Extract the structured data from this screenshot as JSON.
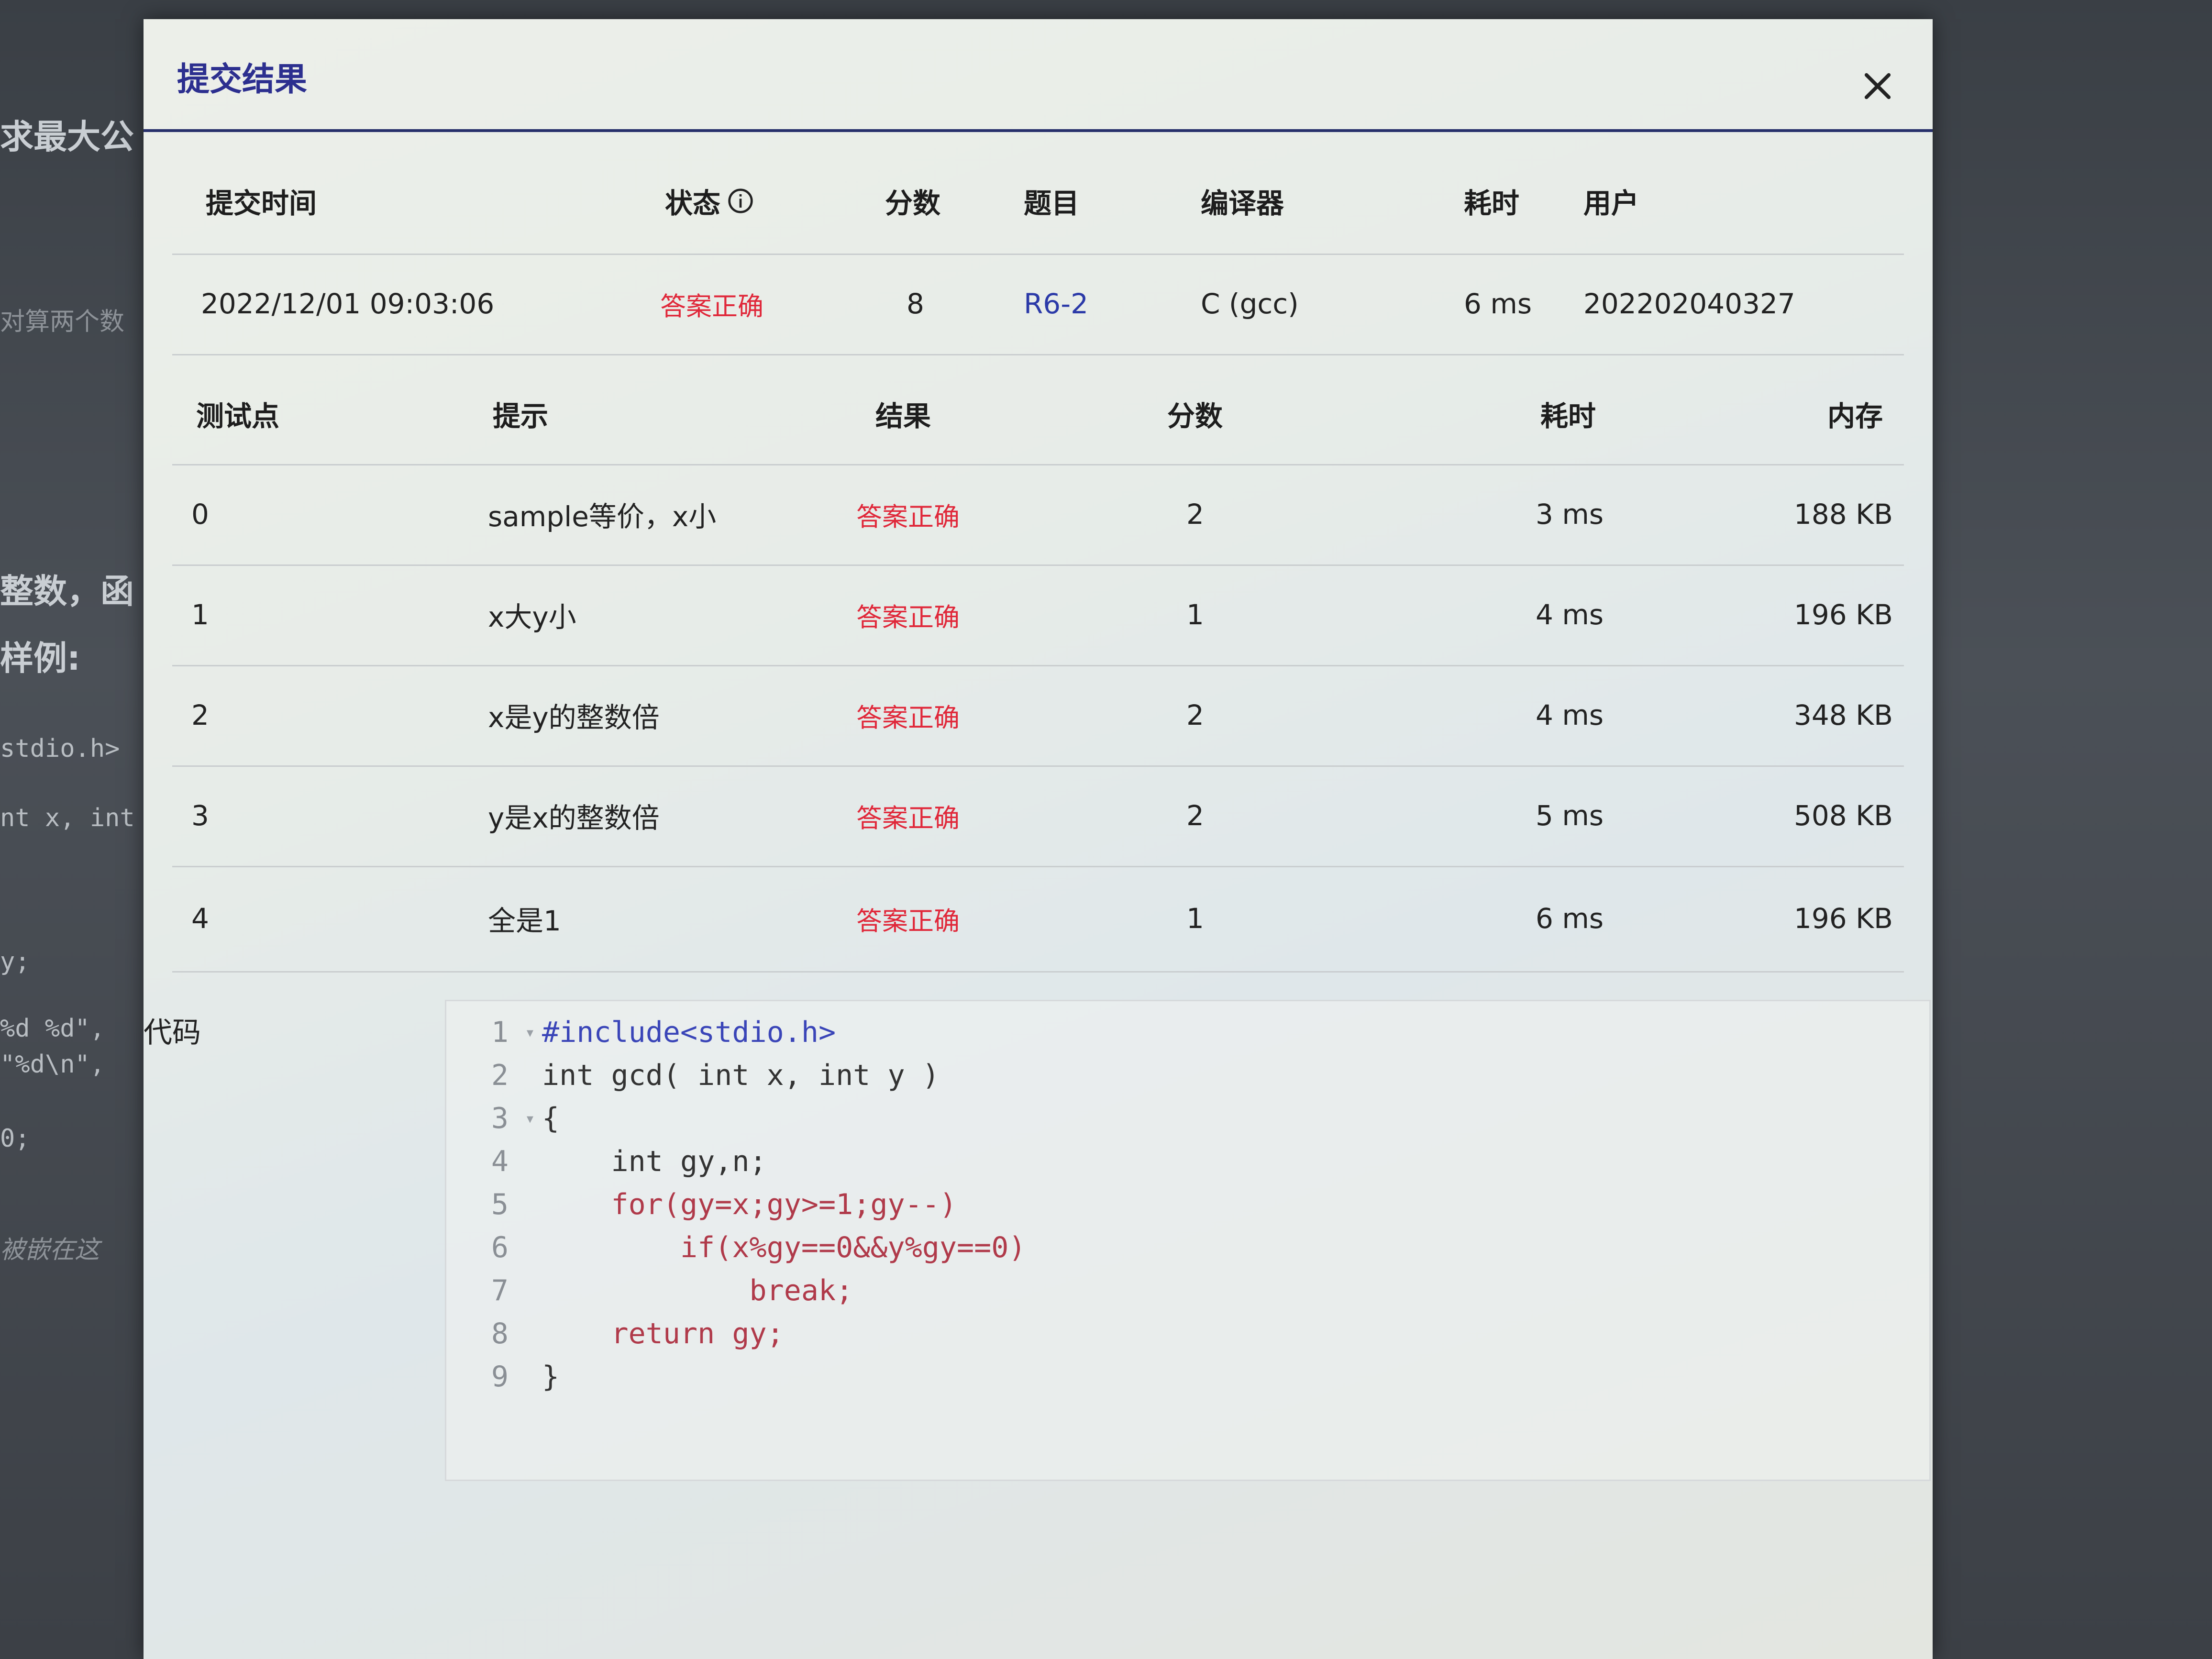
{
  "background": {
    "heading_fragment": "求最大公",
    "line_a": "对算两个数",
    "line_b": "整数，函",
    "heading_b": "样例:",
    "code_lines": [
      "stdio.h>",
      "nt x, int",
      "y;",
      "%d %d\",",
      "\"%d\\n\",",
      "0;",
      "被嵌在这"
    ]
  },
  "modal": {
    "title": "提交结果",
    "close_icon": "close-icon"
  },
  "submission": {
    "headers": {
      "time": "提交时间",
      "status": "状态",
      "score": "分数",
      "problem": "题目",
      "compiler": "编译器",
      "duration": "耗时",
      "user": "用户"
    },
    "row": {
      "time": "2022/12/01 09:03:06",
      "status": "答案正确",
      "score": "8",
      "problem": "R6-2",
      "compiler": "C (gcc)",
      "duration": "6 ms",
      "user": "202202040327"
    }
  },
  "tests": {
    "headers": {
      "case": "测试点",
      "hint": "提示",
      "result": "结果",
      "score": "分数",
      "duration": "耗时",
      "memory": "内存"
    },
    "rows": [
      {
        "case": "0",
        "hint": "sample等价，x小",
        "result": "答案正确",
        "score": "2",
        "duration": "3 ms",
        "memory": "188 KB"
      },
      {
        "case": "1",
        "hint": "x大y小",
        "result": "答案正确",
        "score": "1",
        "duration": "4 ms",
        "memory": "196 KB"
      },
      {
        "case": "2",
        "hint": "x是y的整数倍",
        "result": "答案正确",
        "score": "2",
        "duration": "4 ms",
        "memory": "348 KB"
      },
      {
        "case": "3",
        "hint": "y是x的整数倍",
        "result": "答案正确",
        "score": "2",
        "duration": "5 ms",
        "memory": "508 KB"
      },
      {
        "case": "4",
        "hint": "全是1",
        "result": "答案正确",
        "score": "1",
        "duration": "6 ms",
        "memory": "196 KB"
      }
    ]
  },
  "code": {
    "label": "代码",
    "line_numbers": [
      "1",
      "2",
      "3",
      "4",
      "5",
      "6",
      "7",
      "8",
      "9"
    ],
    "lines": [
      "#include<stdio.h>",
      "int gcd( int x, int y )",
      "{",
      "    int gy,n;",
      "    for(gy=x;gy>=1;gy--)",
      "        if(x%gy==0&&y%gy==0)",
      "            break;",
      "    return gy;",
      "}"
    ]
  },
  "colors": {
    "title": "#2c2f8f",
    "status_ok": "#e0283a",
    "link": "#2b3aa8",
    "header_rule": "#27306b"
  }
}
